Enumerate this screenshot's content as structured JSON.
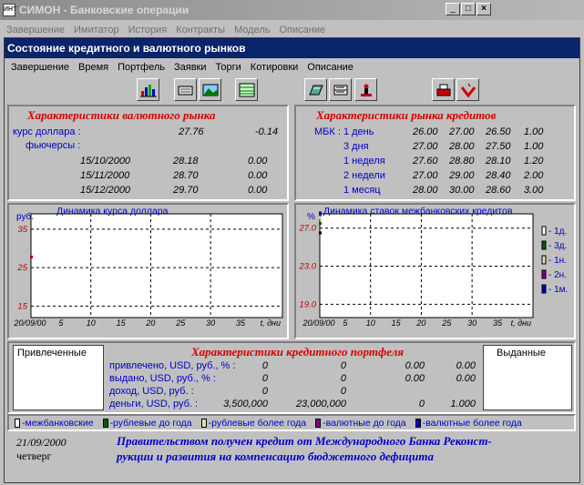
{
  "outer": {
    "title": "СИМОН - Банковские операции",
    "menu": [
      "Завершение",
      "Имитатор",
      "История",
      "Контракты",
      "Модель",
      "Описание"
    ]
  },
  "window": {
    "title": "Состояние кредитного и валютного рынков",
    "menu": [
      "Завершение",
      "Время",
      "Портфель",
      "Заявки",
      "Торги",
      "Котировки",
      "Описание"
    ],
    "toolbar": [
      "bar-chart-icon",
      "cash-icon",
      "landscape-icon",
      "table-icon",
      "folder-icon",
      "card-stack-icon",
      "person-icon",
      "printer-icon",
      "checkmark-icon"
    ]
  },
  "fx": {
    "title": "Характеристики валютного рынка",
    "rate_label": "курс доллара :",
    "rate": "27.76",
    "rate_change": "-0.14",
    "futures_label": "фьючерсы :",
    "futures": [
      {
        "date": "15/10/2000",
        "price": "28.18",
        "change": "0.00"
      },
      {
        "date": "15/11/2000",
        "price": "28.70",
        "change": "0.00"
      },
      {
        "date": "15/12/2000",
        "price": "29.70",
        "change": "0.00"
      }
    ]
  },
  "credit": {
    "title": "Характеристики рынка кредитов",
    "rows": [
      {
        "term": "МБК : 1 день",
        "a": "26.00",
        "b": "27.00",
        "c": "26.50",
        "d": "1.00"
      },
      {
        "term": "3 дня",
        "a": "27.00",
        "b": "28.00",
        "c": "27.50",
        "d": "1.00"
      },
      {
        "term": "1 неделя",
        "a": "27.60",
        "b": "28.80",
        "c": "28.10",
        "d": "1.20"
      },
      {
        "term": "2 недели",
        "a": "27.00",
        "b": "29.00",
        "c": "28.40",
        "d": "2.00"
      },
      {
        "term": "1 месяц",
        "a": "28.00",
        "b": "30.00",
        "c": "28.60",
        "d": "3.00"
      }
    ]
  },
  "chart_data": [
    {
      "type": "line",
      "title": "Динамика курса доллара",
      "ylabel": "руб.",
      "xlabel": "t, дни",
      "x_start_label": "20/09/00",
      "x_ticks": [
        5,
        10,
        15,
        20,
        25,
        30,
        35
      ],
      "y_ticks": [
        15,
        25,
        35
      ],
      "xlim": [
        0,
        42
      ],
      "ylim": [
        12,
        39
      ],
      "grid": true,
      "series": [
        {
          "values": [
            {
              "x": 0,
              "y": 27.76
            }
          ],
          "color": "#a00000"
        }
      ]
    },
    {
      "type": "line",
      "title": "Динамика ставок межбанковских кредитов",
      "ylabel": "%",
      "xlabel": "t, дни",
      "x_start_label": "20/09/00",
      "x_ticks": [
        5,
        10,
        15,
        20,
        25,
        30,
        35
      ],
      "y_ticks": [
        19.0,
        23.0,
        27.0
      ],
      "xlim": [
        0,
        42
      ],
      "ylim": [
        17.6,
        28.5
      ],
      "grid": true,
      "legend_position": "right",
      "series": [
        {
          "name": "1д.",
          "color": "#ffffff",
          "values": [
            {
              "x": 0,
              "y": 26.5
            }
          ]
        },
        {
          "name": "3д.",
          "color": "#006000",
          "values": [
            {
              "x": 0,
              "y": 27.5
            }
          ]
        },
        {
          "name": "1н.",
          "color": "#e0e0b0",
          "values": [
            {
              "x": 0,
              "y": 28.1
            }
          ]
        },
        {
          "name": "2н.",
          "color": "#800080",
          "values": [
            {
              "x": 0,
              "y": 28.4
            }
          ]
        },
        {
          "name": "1м.",
          "color": "#0000c0",
          "values": [
            {
              "x": 0,
              "y": 28.6
            }
          ]
        }
      ]
    }
  ],
  "portfolio": {
    "title": "Характеристики кредитного портфеля",
    "attracted_label": "Привлеченные",
    "issued_label": "Выданные",
    "rows": [
      {
        "label": "привлечено, USD, руб., % :",
        "a": "0",
        "b": "0",
        "c": "0.00",
        "d": "0.00"
      },
      {
        "label": "выдано, USD, руб., % :",
        "a": "0",
        "b": "0",
        "c": "0.00",
        "d": "0.00"
      },
      {
        "label": "доход, USD, руб. :",
        "a": "0",
        "b": "0",
        "c": "",
        "d": ""
      },
      {
        "label": "деньги, USD, руб. :",
        "a": "3,500,000",
        "b": "23,000,000",
        "c": "0",
        "d": "1.000"
      }
    ]
  },
  "legend": [
    {
      "label": "-межбанковские",
      "color": "#ffffff"
    },
    {
      "label": "-рублевые до года",
      "color": "#006000"
    },
    {
      "label": "-рублевые более года",
      "color": "#e0e0b0"
    },
    {
      "label": "-валютные до года",
      "color": "#800080"
    },
    {
      "label": "-валютные более года",
      "color": "#0000c0"
    }
  ],
  "status": {
    "date": "21/09/2000",
    "weekday": "четверг",
    "news_line1": "Правительством получен кредит от Международного Банка Реконст-",
    "news_line2": "рукции и развития на компенсацию бюджетного дефицита"
  }
}
